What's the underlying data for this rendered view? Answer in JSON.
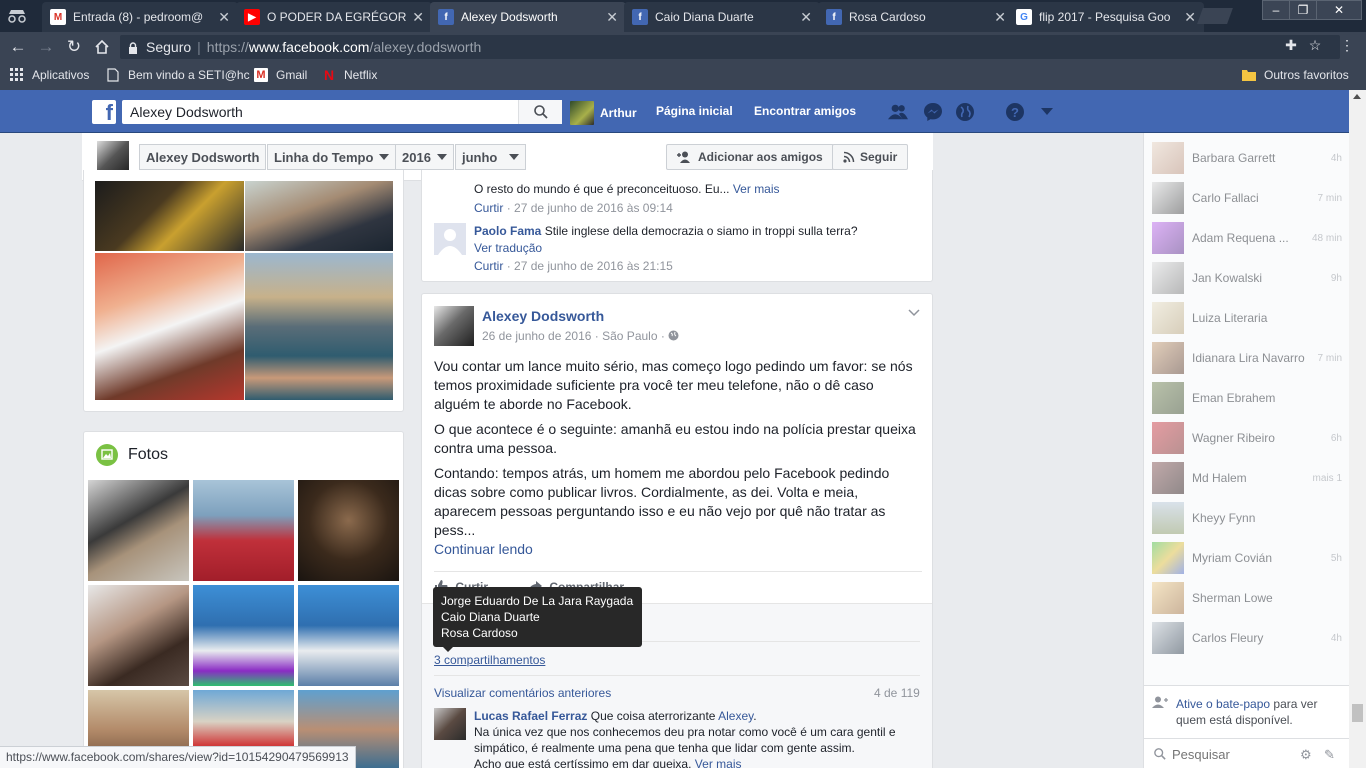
{
  "browser": {
    "tabs": [
      {
        "label": "Entrada (8) - pedroom@",
        "icon": "gmail-icon",
        "color": "#d93025",
        "active": false
      },
      {
        "label": "O PODER DA EGRÉGORA",
        "icon": "youtube-icon",
        "color": "#ff0000",
        "active": false
      },
      {
        "label": "Alexey Dodsworth",
        "icon": "facebook-icon",
        "color": "#4267b2",
        "active": true
      },
      {
        "label": "Caio Diana Duarte",
        "icon": "facebook-icon",
        "color": "#4267b2",
        "active": false
      },
      {
        "label": "Rosa Cardoso",
        "icon": "facebook-icon",
        "color": "#4267b2",
        "active": false
      },
      {
        "label": "flip 2017 - Pesquisa Goo",
        "icon": "google-icon",
        "color": "#4285f4",
        "active": false
      }
    ],
    "secure_label": "Seguro",
    "url_scheme": "https://",
    "url_domain": "www.facebook.com",
    "url_path": "/alexey.dodsworth",
    "bookmarks": [
      {
        "label": "Aplicativos",
        "icon": "apps-icon"
      },
      {
        "label": "Bem vindo a SETI@hc",
        "icon": "page-icon"
      },
      {
        "label": "Gmail",
        "icon": "gmail-icon"
      },
      {
        "label": "Netflix",
        "icon": "netflix-icon"
      }
    ],
    "other_bookmarks": "Outros favoritos",
    "status_url": "https://www.facebook.com/shares/view?id=10154290479569913"
  },
  "fb": {
    "logo": "f",
    "search_value": "Alexey Dodsworth",
    "user_name": "Arthur",
    "nav": [
      "Página inicial",
      "Encontrar amigos"
    ],
    "accent": "#4267b2"
  },
  "timeline_bar": {
    "name": "Alexey Dodsworth",
    "section": "Linha do Tempo",
    "year": "2016",
    "month": "junho",
    "add_friend": "Adicionar aos amigos",
    "follow": "Seguir"
  },
  "photos_card": {
    "title": "Fotos"
  },
  "comments_top": {
    "c1_text": "O resto do mundo é que é preconceituoso. Eu...",
    "c1_more": "Ver mais",
    "c1_like": "Curtir",
    "c1_time": "27 de junho de 2016 às 09:14",
    "c2_author": "Paolo Fama",
    "c2_text": "Stile inglese della democrazia o siamo in troppi sulla terra?",
    "c2_translate": "Ver tradução",
    "c2_like": "Curtir",
    "c2_time": "27 de junho de 2016 às 21:15"
  },
  "post": {
    "author": "Alexey Dodsworth",
    "date": "26 de junho de 2016",
    "place": "São Paulo",
    "p1": "Vou contar um lance muito sério, mas começo logo pedindo um favor: se nós temos proximidade suficiente pra você ter meu telefone, não o dê caso alguém te aborde no Facebook.",
    "p2": "O que acontece é o seguinte: amanhã eu estou indo na polícia prestar queixa contra uma pessoa.",
    "p3": "Contando: tempos atrás, um homem me abordou pelo Facebook pedindo dicas sobre como publicar livros. Cordialmente, as dei. Volta e meia, aparecem pessoas perguntando isso e eu não vejo por quê não tratar as pess...",
    "continue": "Continuar lendo",
    "like": "Curtir",
    "share": "Compartilhar",
    "shares": "3 compartilhamentos",
    "view_previous": "Visualizar comentários anteriores",
    "comment_count": "4 de 119",
    "comment_author": "Lucas Rafael Ferraz",
    "comment_lead": "Que coisa aterrorizante",
    "comment_mention": "Alexey",
    "comment_body": "Na única vez que nos conhecemos deu pra notar como você é um cara gentil e simpático, é realmente uma pena que tenha que lidar com gente assim.",
    "comment_tail": "Acho que está certíssimo em dar queixa.",
    "comment_more": "Ver mais"
  },
  "tooltip": {
    "names": [
      "Jorge Eduardo De La Jara Raygada",
      "Caio Diana Duarte",
      "Rosa Cardoso"
    ]
  },
  "chat": {
    "contacts": [
      {
        "name": "Barbara Garrett",
        "time": "4h"
      },
      {
        "name": "Carlo Fallaci",
        "time": "7 min"
      },
      {
        "name": "Adam Requena ...",
        "time": "48 min"
      },
      {
        "name": "Jan Kowalski",
        "time": "9h"
      },
      {
        "name": "Luiza Literaria",
        "time": ""
      },
      {
        "name": "Idianara Lira Navarro",
        "time": "7 min"
      },
      {
        "name": "Eman Ebrahem",
        "time": ""
      },
      {
        "name": "Wagner Ribeiro",
        "time": "6h"
      },
      {
        "name": "Md Halem",
        "time": "mais 1"
      },
      {
        "name": "Kheyy Fynn",
        "time": ""
      },
      {
        "name": "Myriam Covián",
        "time": "5h"
      },
      {
        "name": "Sherman Lowe",
        "time": ""
      },
      {
        "name": "Carlos Fleury",
        "time": "4h"
      }
    ],
    "activate_link": "Ative o bate-papo",
    "activate_rest": "para ver quem está disponível.",
    "search_placeholder": "Pesquisar"
  }
}
